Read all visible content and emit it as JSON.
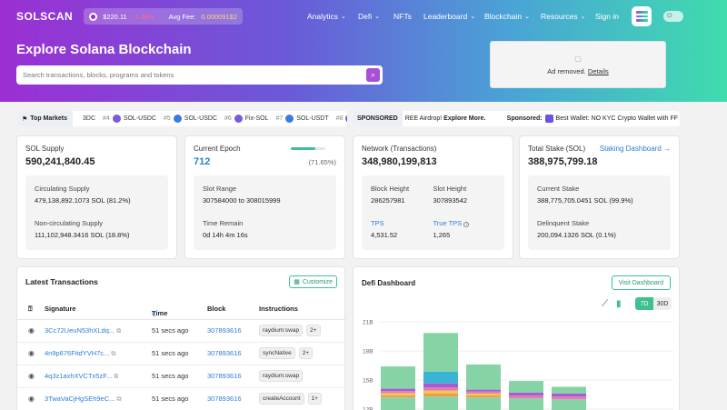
{
  "nav": {
    "logo": "SOLSCAN",
    "price": "$220.11",
    "price_change": "-1.48%",
    "avg_fee_label": "Avg Fee:",
    "avg_fee_value": "0.000091$2",
    "menu": [
      {
        "label": "Analytics",
        "dropdown": true
      },
      {
        "label": "Defi",
        "dropdown": true
      },
      {
        "label": "NFTs",
        "dropdown": false
      },
      {
        "label": "Leaderboard",
        "dropdown": true
      },
      {
        "label": "Blockchain",
        "dropdown": true
      },
      {
        "label": "Resources",
        "dropdown": true
      },
      {
        "label": "Sign in",
        "dropdown": false
      }
    ]
  },
  "hero": {
    "title": "Explore Solana Blockchain",
    "search_placeholder": "Search transactions, blocks, programs and tokens"
  },
  "ad": {
    "text": "Ad removed.",
    "link": "Details"
  },
  "markets": {
    "label": "Top Markets",
    "items": [
      {
        "rank": "",
        "pair": "3DC"
      },
      {
        "rank": "#4",
        "pair": "SOL-USDC"
      },
      {
        "rank": "#5",
        "pair": "SOL-USDC"
      },
      {
        "rank": "#6",
        "pair": "Fix-SOL"
      },
      {
        "rank": "#7",
        "pair": "SOL-USDT"
      },
      {
        "rank": "#8",
        "pair": ""
      }
    ]
  },
  "sponsor": {
    "tag": "SPONSORED",
    "text": "REE Airdrop!",
    "text_bold": "Explore More.",
    "right_label": "Sponsored:",
    "right_text": "Best Wallet: NO KYC Crypto Wallet with FF"
  },
  "stats": {
    "supply": {
      "label": "SOL Supply",
      "value": "590,241,840.45",
      "circ_label": "Circulating Supply",
      "circ_value": "479,138,892.1073 SOL (81.2%)",
      "noncirc_label": "Non-circulating Supply",
      "noncirc_value": "111,102,948.3416 SOL (18.8%)"
    },
    "epoch": {
      "label": "Current Epoch",
      "value": "712",
      "progress": 0.7165,
      "progress_text": "(71.65%)",
      "slot_label": "Slot Range",
      "slot_value": "307584000 to 308015999",
      "remain_label": "Time Remain",
      "remain_value": "0d 14h 4m 16s"
    },
    "network": {
      "label": "Network (Transactions)",
      "value": "348,980,199,813",
      "bh_label": "Block Height",
      "bh_value": "286257981",
      "sh_label": "Slot Height",
      "sh_value": "307893542",
      "tps_label": "TPS",
      "tps_value": "4,531.52",
      "ttps_label": "True TPS",
      "ttps_value": "1,265"
    },
    "stake": {
      "label": "Total Stake (SOL)",
      "value": "388,975,799.18",
      "link": "Staking Dashboard →",
      "cur_label": "Current Stake",
      "cur_value": "388,775,705.0451 SOL (99.9%)",
      "del_label": "Delinquent Stake",
      "del_value": "200,094.1326 SOL (0.1%)"
    }
  },
  "transactions": {
    "title": "Latest Transactions",
    "customize": "Customize",
    "headers": {
      "signature": "Signature",
      "time": "Time",
      "block": "Block",
      "instructions": "Instructions"
    },
    "rows": [
      {
        "sig": "3Cc72UeuN53hXLdq...",
        "time": "51 secs ago",
        "block": "307893616",
        "instr": "raydium:swap",
        "extra": "2+"
      },
      {
        "sig": "4n9p676FitdYVH7c...",
        "time": "51 secs ago",
        "block": "307893616",
        "instr": "syncNative",
        "extra": "2+"
      },
      {
        "sig": "4q3z1axhXVCTx5zF...",
        "time": "51 secs ago",
        "block": "307893616",
        "instr": "raydium:swap",
        "extra": ""
      },
      {
        "sig": "3TwaVaCjHgSEh9eC...",
        "time": "51 secs ago",
        "block": "307893616",
        "instr": "createAccount",
        "extra": "1+"
      }
    ]
  },
  "defi": {
    "title": "Defi Dashboard",
    "visit": "Visit Dashboard",
    "range_7d": "7D",
    "range_30d": "30D",
    "colors": {
      "green": "#86d4a6",
      "teal": "#39b4d4",
      "purple": "#a75cd6",
      "pink": "#e07bb6",
      "yellow": "#f2c84b",
      "orange": "#f29a4b"
    }
  },
  "chart_data": {
    "type": "bar",
    "ytick_labels": [
      "21B",
      "18B",
      "15B",
      "12B"
    ],
    "ylim": [
      12,
      21
    ],
    "stack_order": [
      "green",
      "teal",
      "purple",
      "pink",
      "yellow",
      "orange"
    ],
    "bars": [
      {
        "segments": {
          "green": 2.3,
          "teal": 0.0,
          "purple": 0.25,
          "pink": 0.2,
          "yellow": 0.25,
          "orange": 0.2
        }
      },
      {
        "segments": {
          "green": 4.0,
          "teal": 1.2,
          "purple": 0.4,
          "pink": 0.35,
          "yellow": 0.3,
          "orange": 0.3
        }
      },
      {
        "segments": {
          "green": 2.6,
          "teal": 0.0,
          "purple": 0.2,
          "pink": 0.2,
          "yellow": 0.2,
          "orange": 0.2
        }
      },
      {
        "segments": {
          "green": 1.2,
          "teal": 0.0,
          "purple": 0.3,
          "pink": 0.3,
          "yellow": 0.0,
          "orange": 0.0
        }
      },
      {
        "segments": {
          "green": 0.7,
          "teal": 0.0,
          "purple": 0.3,
          "pink": 0.3,
          "yellow": 0.0,
          "orange": 0.0
        }
      }
    ]
  }
}
